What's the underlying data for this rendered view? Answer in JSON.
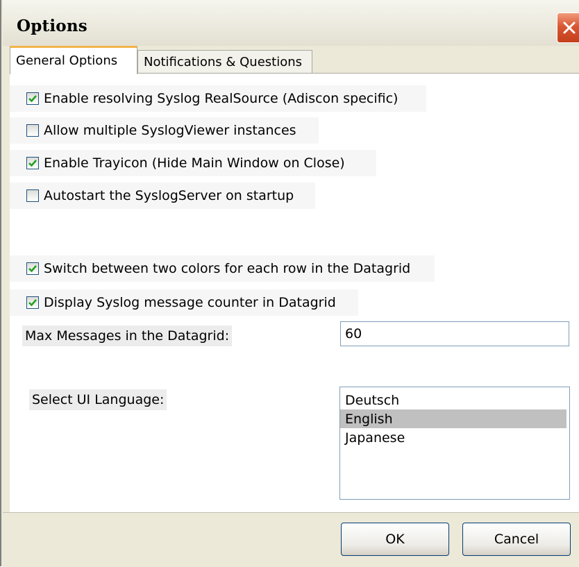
{
  "window": {
    "title": "Options"
  },
  "tabs": [
    {
      "label": "General Options",
      "active": true
    },
    {
      "label": "Notifications & Questions",
      "active": false
    }
  ],
  "options": [
    {
      "label": "Enable resolving Syslog RealSource (Adiscon specific)",
      "checked": true
    },
    {
      "label": "Allow multiple SyslogViewer instances",
      "checked": false
    },
    {
      "label": "Enable Trayicon (Hide Main Window on Close)",
      "checked": true
    },
    {
      "label": "Autostart the SyslogServer on startup",
      "checked": false
    },
    {
      "label": "Switch between two colors for each row in the Datagrid",
      "checked": true
    },
    {
      "label": "Display Syslog message counter in Datagrid",
      "checked": true
    }
  ],
  "max_messages": {
    "label": "Max Messages in the Datagrid:",
    "value": "60"
  },
  "language": {
    "label": "Select UI Language:",
    "options": [
      "Deutsch",
      "English",
      "Japanese"
    ],
    "selected": "English"
  },
  "buttons": {
    "ok": "OK",
    "cancel": "Cancel"
  },
  "colors": {
    "checkmark": "#21a121",
    "close_button": "#d85732",
    "active_tab_accent": "#f2b44a",
    "selection": "#c0c0c0"
  }
}
